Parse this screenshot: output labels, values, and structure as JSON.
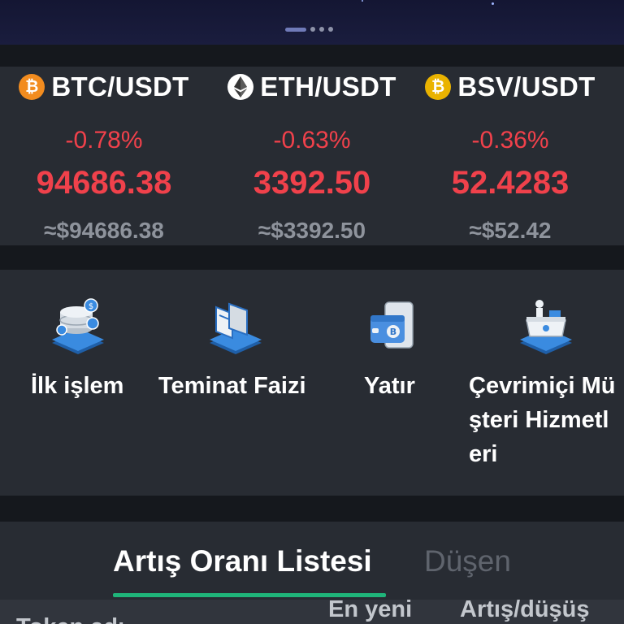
{
  "banner": {
    "indicator_count": 4,
    "active_index": 0
  },
  "tickers": [
    {
      "pair": "BTC/USDT",
      "coin": "btc-coin-icon",
      "change": "-0.78%",
      "price": "94686.38",
      "usd": "≈$94686.38"
    },
    {
      "pair": "ETH/USDT",
      "coin": "eth-coin-icon",
      "change": "-0.63%",
      "price": "3392.50",
      "usd": "≈$3392.50"
    },
    {
      "pair": "BSV/USDT",
      "coin": "bsv-coin-icon",
      "change": "-0.36%",
      "price": "52.4283",
      "usd": "≈$52.42"
    }
  ],
  "actions": [
    {
      "label": "İlk işlem",
      "icon": "database-coins-icon"
    },
    {
      "label": "Teminat Faizi",
      "icon": "cards-stack-icon"
    },
    {
      "label": "Yatır",
      "icon": "wallet-phone-icon"
    },
    {
      "label_lines": [
        "Çevrimiçi Mü",
        "şteri Hizmetl",
        "eri"
      ],
      "icon": "service-desk-icon"
    }
  ],
  "tabs": {
    "active": "Artış Oranı Listesi",
    "other": "Düşen"
  },
  "list_header": {
    "col1": "Token adı",
    "col2": "En yeni",
    "col3": "Artış/düşüş"
  },
  "colors": {
    "down_red": "#f0414b",
    "accent_green": "#1fb57a",
    "panel": "#282c33",
    "background": "#15181d"
  }
}
